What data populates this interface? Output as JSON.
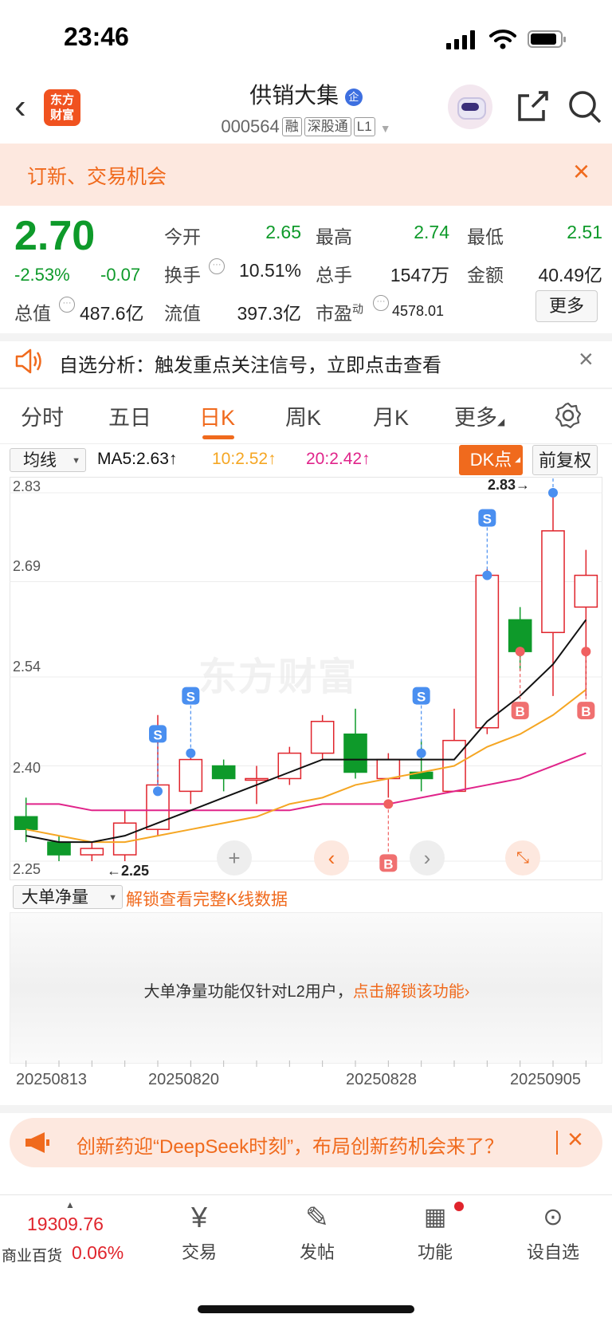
{
  "status_bar": {
    "time": "23:46"
  },
  "header": {
    "logo_line1": "东方",
    "logo_line2": "财富",
    "title": "供销大集",
    "title_badge": "企",
    "code": "000564",
    "tags": [
      "融",
      "深股通",
      "L1"
    ]
  },
  "banner": {
    "text": "订新、交易机会"
  },
  "quote": {
    "price": "2.70",
    "change_pct": "-2.53%",
    "change": "-0.07",
    "fields": {
      "open_label": "今开",
      "open": "2.65",
      "high_label": "最高",
      "high": "2.74",
      "low_label": "最低",
      "low": "2.51",
      "turnover_label": "换手",
      "turnover": "10.51%",
      "volume_label": "总手",
      "volume": "1547万",
      "amount_label": "金额",
      "amount": "40.49亿",
      "mktcap_label": "总值",
      "mktcap": "487.6亿",
      "float_label": "流值",
      "float": "397.3亿",
      "pe_label": "市盈",
      "pe_sup": "动",
      "pe": "4578.01"
    },
    "more_button": "更多"
  },
  "alert": {
    "text": "自选分析：触发重点关注信号，立即点击查看"
  },
  "tabs": [
    "分时",
    "五日",
    "日K",
    "周K",
    "月K",
    "更多"
  ],
  "active_tab": "日K",
  "indicator_bar": {
    "select": "均线",
    "ma5": "MA5:2.63↑",
    "ma10": "10:2.52↑",
    "ma20": "20:2.42↑",
    "dk_button": "DK点",
    "adjust_button": "前复权"
  },
  "chart_data": {
    "type": "candlestick",
    "price_ticks": [
      "2.83",
      "2.69",
      "2.54",
      "2.40",
      "2.25"
    ],
    "ylim": [
      2.24,
      2.84
    ],
    "high_annotation": "2.83→",
    "low_annotation": "←2.25",
    "dates": [
      "20250813",
      "20250820",
      "20250828",
      "20250905"
    ],
    "watermark": "东方财富",
    "candles": [
      {
        "o": 2.32,
        "c": 2.3,
        "h": 2.35,
        "l": 2.28
      },
      {
        "o": 2.28,
        "c": 2.26,
        "h": 2.29,
        "l": 2.25
      },
      {
        "o": 2.26,
        "c": 2.27,
        "h": 2.28,
        "l": 2.25
      },
      {
        "o": 2.26,
        "c": 2.31,
        "h": 2.33,
        "l": 2.25
      },
      {
        "o": 2.3,
        "c": 2.37,
        "h": 2.48,
        "l": 2.29
      },
      {
        "o": 2.36,
        "c": 2.41,
        "h": 2.42,
        "l": 2.34
      },
      {
        "o": 2.4,
        "c": 2.38,
        "h": 2.41,
        "l": 2.36
      },
      {
        "o": 2.38,
        "c": 2.38,
        "h": 2.4,
        "l": 2.34
      },
      {
        "o": 2.38,
        "c": 2.42,
        "h": 2.43,
        "l": 2.37
      },
      {
        "o": 2.42,
        "c": 2.47,
        "h": 2.48,
        "l": 2.41
      },
      {
        "o": 2.45,
        "c": 2.39,
        "h": 2.49,
        "l": 2.38
      },
      {
        "o": 2.38,
        "c": 2.41,
        "h": 2.42,
        "l": 2.35
      },
      {
        "o": 2.39,
        "c": 2.38,
        "h": 2.44,
        "l": 2.36
      },
      {
        "o": 2.36,
        "c": 2.44,
        "h": 2.49,
        "l": 2.36
      },
      {
        "o": 2.46,
        "c": 2.7,
        "h": 2.71,
        "l": 2.45
      },
      {
        "o": 2.63,
        "c": 2.58,
        "h": 2.65,
        "l": 2.55
      },
      {
        "o": 2.61,
        "c": 2.77,
        "h": 2.83,
        "l": 2.51
      },
      {
        "o": 2.65,
        "c": 2.7,
        "h": 2.74,
        "l": 2.51
      }
    ],
    "ma5": [
      2.29,
      2.28,
      2.28,
      2.29,
      2.31,
      2.33,
      2.35,
      2.37,
      2.39,
      2.41,
      2.41,
      2.41,
      2.41,
      2.41,
      2.47,
      2.51,
      2.56,
      2.63
    ],
    "ma10": [
      2.3,
      2.29,
      2.28,
      2.28,
      2.29,
      2.3,
      2.31,
      2.32,
      2.34,
      2.35,
      2.37,
      2.38,
      2.39,
      2.4,
      2.43,
      2.45,
      2.48,
      2.52
    ],
    "ma20": [
      2.34,
      2.34,
      2.33,
      2.33,
      2.33,
      2.33,
      2.33,
      2.33,
      2.33,
      2.34,
      2.34,
      2.34,
      2.35,
      2.36,
      2.37,
      2.38,
      2.4,
      2.42
    ],
    "signals": [
      {
        "i": 4,
        "type": "S",
        "price": 2.36
      },
      {
        "i": 5,
        "type": "S",
        "price": 2.42
      },
      {
        "i": 11,
        "type": "B",
        "price": 2.34
      },
      {
        "i": 12,
        "type": "S",
        "price": 2.42
      },
      {
        "i": 14,
        "type": "S",
        "price": 2.7
      },
      {
        "i": 15,
        "type": "B",
        "price": 2.58
      },
      {
        "i": 16,
        "type": "S",
        "price": 2.83
      },
      {
        "i": 17,
        "type": "B",
        "price": 2.58
      }
    ]
  },
  "volume_panel": {
    "select": "大单净量",
    "unlock_link": "解锁查看完整K线数据",
    "message": "大单净量功能仅针对L2用户，",
    "message_link": "点击解锁该功能"
  },
  "news": {
    "text": "创新药迎“DeepSeek时刻”，布局创新药机会来了？"
  },
  "bottom_nav": {
    "index_value": "19309.76",
    "index_name": "商业百货",
    "index_change": "0.06%",
    "items": [
      "交易",
      "发帖",
      "功能",
      "设自选"
    ]
  },
  "colors": {
    "up": "#e0242c",
    "down": "#0e9a2a",
    "accent": "#f06a1d",
    "signal_s": "#4a8ff0"
  }
}
